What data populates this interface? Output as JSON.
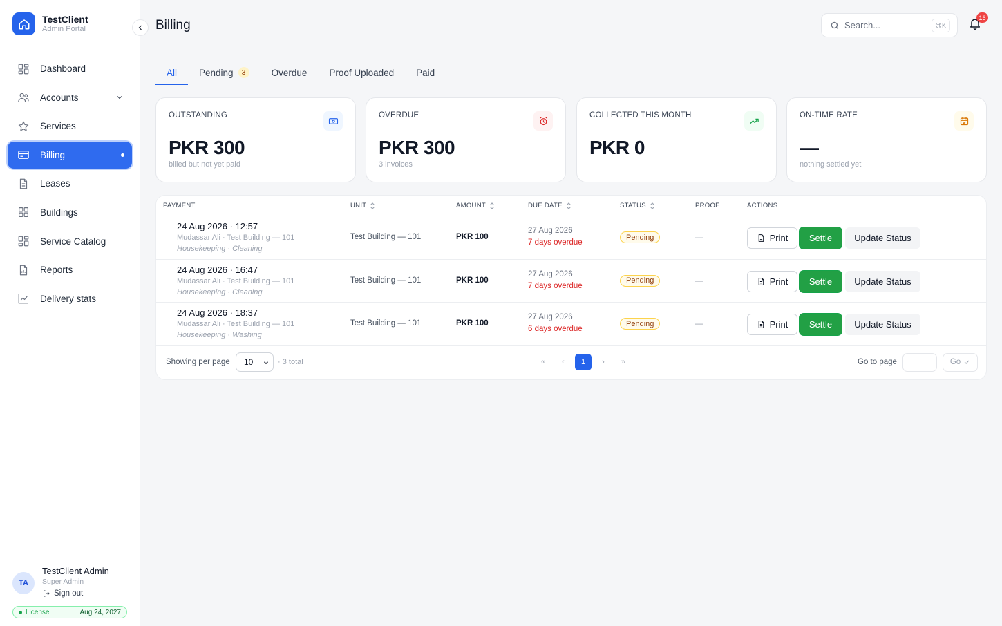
{
  "brand": {
    "name": "TestClient",
    "subtitle": "Admin Portal"
  },
  "sidebar": {
    "items": [
      {
        "label": "Dashboard",
        "icon": "dashboard-grid-icon"
      },
      {
        "label": "Accounts",
        "icon": "users-icon",
        "has_chevron": true
      },
      {
        "label": "Services",
        "icon": "star-icon"
      },
      {
        "label": "Billing",
        "icon": "credit-card-icon",
        "active": true
      },
      {
        "label": "Leases",
        "icon": "document-icon"
      },
      {
        "label": "Buildings",
        "icon": "grid-icon"
      },
      {
        "label": "Service Catalog",
        "icon": "catalog-grid-icon"
      },
      {
        "label": "Reports",
        "icon": "report-icon"
      },
      {
        "label": "Delivery stats",
        "icon": "line-chart-icon"
      }
    ]
  },
  "user": {
    "initials": "TA",
    "name": "TestClient Admin",
    "role": "Super Admin",
    "signout": "Sign out"
  },
  "license": {
    "label": "License",
    "date": "Aug 24, 2027"
  },
  "header": {
    "title": "Billing",
    "search_placeholder": "Search...",
    "search_shortcut": "⌘K",
    "notification_count": "16"
  },
  "tabs": [
    {
      "label": "All",
      "active": true
    },
    {
      "label": "Pending",
      "badge": "3"
    },
    {
      "label": "Overdue"
    },
    {
      "label": "Proof Uploaded"
    },
    {
      "label": "Paid"
    }
  ],
  "cards": [
    {
      "label": "OUTSTANDING",
      "value": "PKR 300",
      "sub": "billed but not yet paid",
      "icon": "cash-icon",
      "accent": "#2563eb"
    },
    {
      "label": "OVERDUE",
      "value": "PKR 300",
      "sub": "3 invoices",
      "icon": "alarm-clock-icon",
      "accent": "#dc2626"
    },
    {
      "label": "COLLECTED THIS MONTH",
      "value": "PKR 0",
      "sub": "",
      "icon": "trending-up-icon",
      "accent": "#16a34a"
    },
    {
      "label": "ON-TIME RATE",
      "value": "—",
      "sub": "nothing settled yet",
      "icon": "calendar-icon",
      "accent": "#d97706"
    }
  ],
  "table": {
    "columns": [
      "PAYMENT",
      "UNIT",
      "AMOUNT",
      "DUE DATE",
      "STATUS",
      "PROOF",
      "ACTIONS"
    ],
    "rows": [
      {
        "title": "24 Aug 2026 · 12:57",
        "sub": "Mudassar Ali · Test Building — 101",
        "tags": "Housekeeping · Cleaning",
        "unit": "Test Building — 101",
        "amount": "PKR 100",
        "due": "27 Aug 2026",
        "overdue": "7 days overdue",
        "status": "Pending",
        "proof": "—"
      },
      {
        "title": "24 Aug 2026 · 16:47",
        "sub": "Mudassar Ali · Test Building — 101",
        "tags": "Housekeeping · Cleaning",
        "unit": "Test Building — 101",
        "amount": "PKR 100",
        "due": "27 Aug 2026",
        "overdue": "7 days overdue",
        "status": "Pending",
        "proof": "—"
      },
      {
        "title": "24 Aug 2026 · 18:37",
        "sub": "Mudassar Ali · Test Building — 101",
        "tags": "Housekeeping · Washing",
        "unit": "Test Building — 101",
        "amount": "PKR 100",
        "due": "27 Aug 2026",
        "overdue": "6 days overdue",
        "status": "Pending",
        "proof": "—"
      }
    ],
    "actions": {
      "print": "Print",
      "settle": "Settle",
      "update": "Update Status"
    }
  },
  "footer": {
    "per_page_label": "Showing per page",
    "per_page_value": "10",
    "total": "· 3 total",
    "pages": {
      "first": "«",
      "prev": "‹",
      "current": "1",
      "next": "›",
      "last": "»"
    },
    "goto_label": "Go to page",
    "go": "Go"
  }
}
